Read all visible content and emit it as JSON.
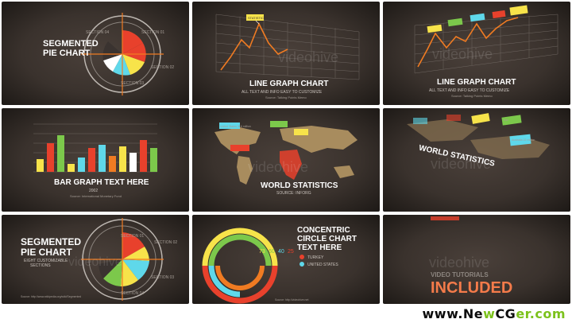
{
  "tiles": {
    "seg1": {
      "title_line1": "SEGMENTED",
      "title_line2": "PIE CHART",
      "labels": [
        "SECTION 01",
        "SECTION 02",
        "SECTION 03",
        "SECTION 04"
      ]
    },
    "line1": {
      "title": "LINE GRAPH CHART",
      "subtitle": "ALL TEXT AND INFO EASY TO CUSTOMIZE",
      "source": "Source: Talking Points Memo",
      "callout": "STATISTIC 01"
    },
    "line2": {
      "title": "LINE GRAPH CHART",
      "subtitle": "ALL TEXT AND INFO EASY TO CUSTOMIZE",
      "source": "Source: Talking Points Memo"
    },
    "bar": {
      "title": "BAR GRAPH TEXT HERE",
      "year": "2002",
      "source": "Source: International Monetary Fund"
    },
    "world1": {
      "title": "WORLD STATISTICS",
      "subtitle": "SOURCE: INFORG",
      "callouts": [
        "United States 316 million",
        "Argentina 41 million",
        "Brazil 193 million",
        "Russia 143 million",
        "China 1.3 billion"
      ]
    },
    "world2": {
      "title": "WORLD STATISTICS",
      "callouts": [
        "Iran",
        "Australia 22 million"
      ]
    },
    "seg2": {
      "title_line1": "SEGMENTED",
      "title_line2": "PIE CHART",
      "subtitle_line1": "EIGHT CUSTOMIZABLE",
      "subtitle_line2": "SECTIONS",
      "labels": [
        "SECTION 01",
        "SECTION 02",
        "SECTION 03",
        "SECTION 04"
      ],
      "source": "Source: http://www.wikipedia.org/wiki/Segmented"
    },
    "concentric": {
      "title_line1": "CONCENTRIC",
      "title_line2": "CIRCLE CHART",
      "title_line3": "TEXT HERE",
      "values": [
        "73",
        "60",
        "40",
        "25"
      ],
      "legend": [
        "TURKEY",
        "UNITED STATES"
      ],
      "source": "Source: http://videohive.net"
    },
    "tutorials": {
      "line1": "VIDEO TUTORIALS",
      "line2": "INCLUDED"
    }
  },
  "footer": {
    "brand_prefix": "www.Ne",
    "brand_w": "w",
    "brand_cg": "CG",
    "brand_suffix": "er.com"
  },
  "colors": {
    "red": "#e8412c",
    "yellow": "#f7e34a",
    "cyan": "#5fd8ea",
    "green": "#7cc84b",
    "orange": "#f07b22"
  }
}
